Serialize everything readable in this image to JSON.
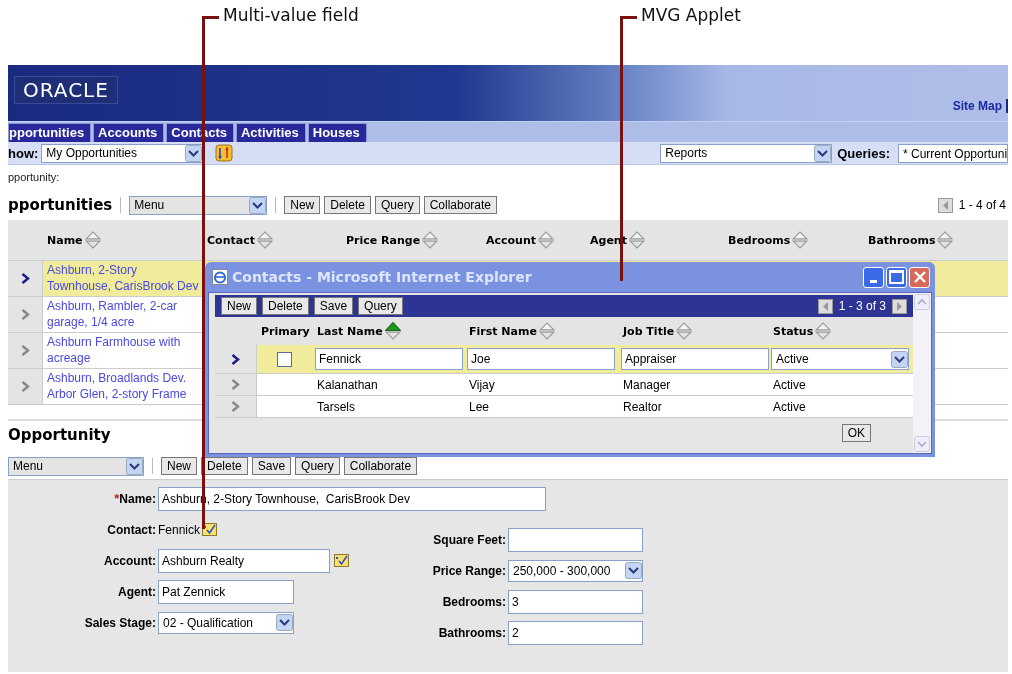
{
  "callouts": [
    {
      "label": "Multi-value field"
    },
    {
      "label": "MVG Applet"
    }
  ],
  "header": {
    "logo": "ORACLE",
    "links": [
      "Site Map"
    ]
  },
  "tabs": [
    {
      "label": "pportunities"
    },
    {
      "label": "Accounts"
    },
    {
      "label": "Contacts"
    },
    {
      "label": "Activities"
    },
    {
      "label": "Houses"
    }
  ],
  "show_bar": {
    "label": "how:",
    "view": "My Opportunities",
    "reports": "Reports",
    "queries_label": "Queries:",
    "query": "* Current Opportuni"
  },
  "breadcrumb": "pportunity:",
  "list_applet": {
    "title": "pportunities",
    "menu": "Menu",
    "buttons": [
      "New",
      "Delete",
      "Query",
      "Collaborate"
    ],
    "pager": "1 - 4 of 4",
    "columns": [
      "Name",
      "Contact",
      "Price Range",
      "Account",
      "Agent",
      "Bedrooms",
      "Bathrooms"
    ],
    "rows": [
      {
        "name": "Ashburn, 2-Story Townhouse, CarisBrook Dev",
        "selected": true
      },
      {
        "name": "Ashburn, Rambler, 2-car garage, 1/4 acre",
        "selected": false
      },
      {
        "name": "Ashburn Farmhouse with acreage",
        "selected": false
      },
      {
        "name": "Ashburn, Broadlands Dev. Arbor Glen, 2-story Frame",
        "selected": false
      }
    ]
  },
  "popup": {
    "title": "Contacts - Microsoft Internet Explorer",
    "buttons": [
      "New",
      "Delete",
      "Save",
      "Query"
    ],
    "pager": "1 - 3 of 3",
    "columns": [
      {
        "label": "Primary",
        "sortable": false
      },
      {
        "label": "Last Name",
        "sortable": true,
        "sorted": true
      },
      {
        "label": "First Name",
        "sortable": true,
        "sorted": false
      },
      {
        "label": "Job Title",
        "sortable": true,
        "sorted": false
      },
      {
        "label": "Status",
        "sortable": true,
        "sorted": false
      }
    ],
    "rows": [
      {
        "selected": true,
        "primary": false,
        "last_name": "Fennick",
        "first_name": "Joe",
        "job_title": "Appraiser",
        "status": "Active"
      },
      {
        "selected": false,
        "primary": false,
        "last_name": "Kalanathan",
        "first_name": "Vijay",
        "job_title": "Manager",
        "status": "Active"
      },
      {
        "selected": false,
        "primary": false,
        "last_name": "Tarsels",
        "first_name": "Lee",
        "job_title": "Realtor",
        "status": "Active"
      }
    ],
    "ok": "OK"
  },
  "form_applet": {
    "title": "Opportunity",
    "menu": "Menu",
    "buttons": [
      "New",
      "Delete",
      "Save",
      "Query",
      "Collaborate"
    ],
    "name_field": {
      "required_mark": "*",
      "label": "Name:",
      "value": "Ashburn, 2-Story Townhouse,  CarisBrook Dev"
    },
    "fields_left": [
      {
        "label": "Contact:",
        "value": "Fennick",
        "kind": "mvg"
      },
      {
        "label": "Account:",
        "value": "Ashburn Realty",
        "kind": "pick"
      },
      {
        "label": "Agent:",
        "value": "Pat Zennick",
        "kind": "text"
      },
      {
        "label": "Sales Stage:",
        "value": "02 - Qualification",
        "kind": "select"
      }
    ],
    "fields_right": [
      {
        "label": "Square Feet:",
        "kind": "text"
      },
      {
        "label": "Price Range:",
        "value": "250,000 - 300,000",
        "kind": "select"
      },
      {
        "label": "Bedrooms:",
        "value": "3",
        "kind": "text"
      },
      {
        "label": "Bathrooms:",
        "value": "2",
        "kind": "text"
      }
    ]
  }
}
